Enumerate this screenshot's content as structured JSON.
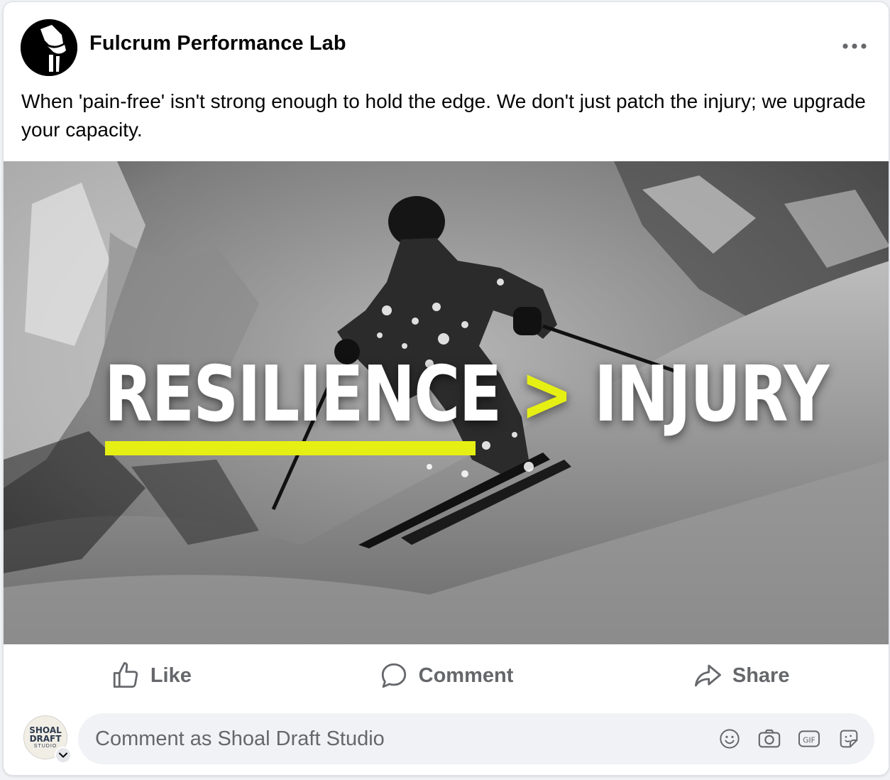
{
  "post": {
    "page_name": "Fulcrum Performance Lab",
    "text": "When 'pain-free' isn't strong enough to hold the edge. We don't just patch the injury; we upgrade your capacity."
  },
  "image": {
    "headline_left": "RESILIENCE",
    "headline_symbol": ">",
    "headline_right": "INJURY",
    "accent_color": "#e6ef13"
  },
  "actions": {
    "like_label": "Like",
    "comment_label": "Comment",
    "share_label": "Share"
  },
  "composer": {
    "placeholder": "Comment as Shoal Draft Studio",
    "avatar_line1": "SHOAL",
    "avatar_line2": "DRAFT",
    "avatar_line3": "STUDIO"
  },
  "icons": {
    "avatar": "knee-joint-logo",
    "more": "more-horizontal-icon",
    "like": "thumbs-up-icon",
    "comment": "speech-bubble-icon",
    "share": "share-arrow-icon",
    "emoji": "smiley-icon",
    "camera": "camera-icon",
    "gif": "gif-icon",
    "sticker": "sticker-icon"
  }
}
